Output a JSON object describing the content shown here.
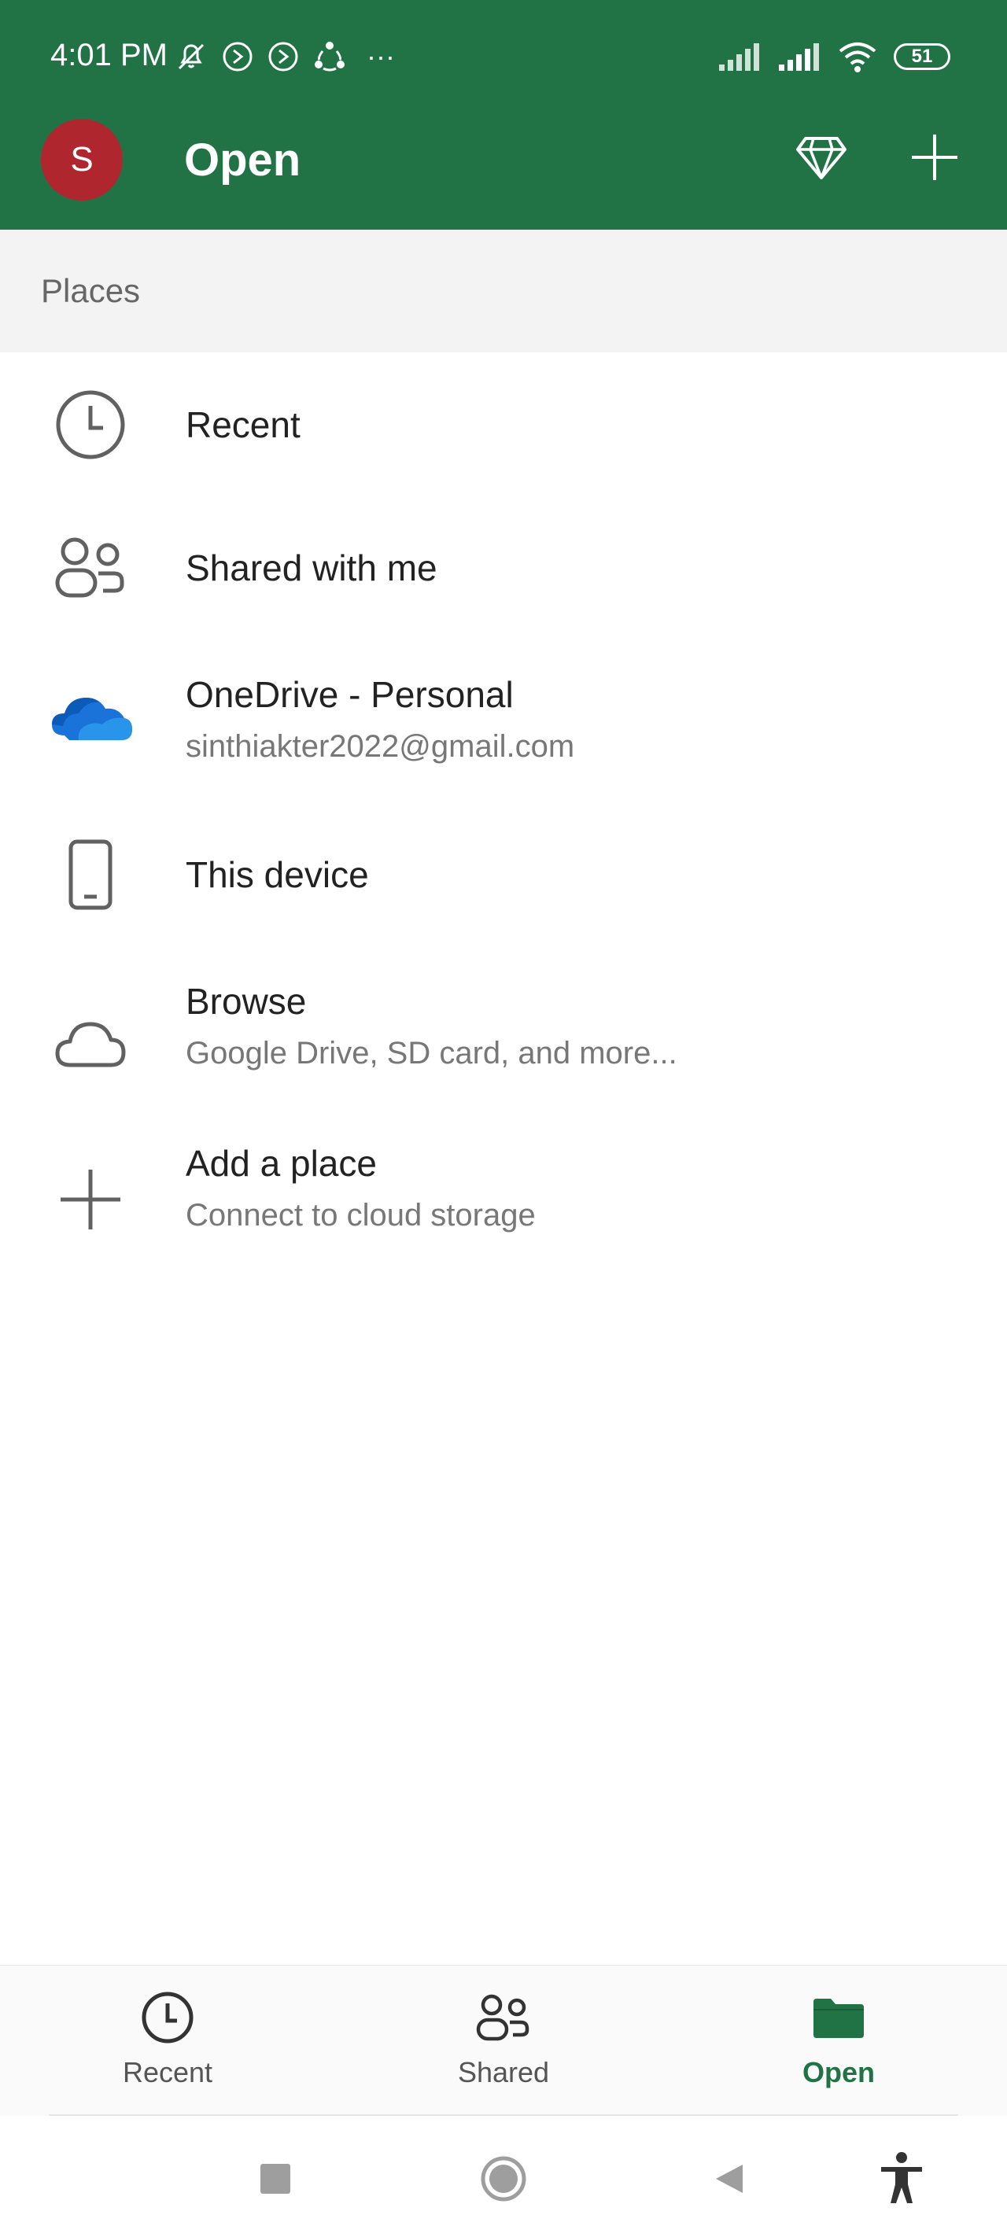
{
  "status_bar": {
    "time": "4:01 PM",
    "more": "···",
    "battery": "51"
  },
  "header": {
    "avatar_initial": "S",
    "title": "Open"
  },
  "places": {
    "label": "Places",
    "items": [
      {
        "title": "Recent",
        "subtitle": "",
        "icon": "clock-icon"
      },
      {
        "title": "Shared with me",
        "subtitle": "",
        "icon": "people-icon"
      },
      {
        "title": "OneDrive - Personal",
        "subtitle": "sinthiakter2022@gmail.com",
        "icon": "onedrive-icon"
      },
      {
        "title": "This device",
        "subtitle": "",
        "icon": "phone-icon"
      },
      {
        "title": "Browse",
        "subtitle": "Google Drive, SD card, and more...",
        "icon": "cloud-icon"
      },
      {
        "title": "Add a place",
        "subtitle": "Connect to cloud storage",
        "icon": "plus-icon"
      }
    ]
  },
  "bottom_nav": {
    "items": [
      {
        "label": "Recent",
        "icon": "clock-icon",
        "active": false
      },
      {
        "label": "Shared",
        "icon": "people-icon",
        "active": false
      },
      {
        "label": "Open",
        "icon": "folder-icon",
        "active": true
      }
    ]
  },
  "colors": {
    "brand": "#217346",
    "avatar": "#b0262f",
    "onedrive": "#1a73d9"
  }
}
